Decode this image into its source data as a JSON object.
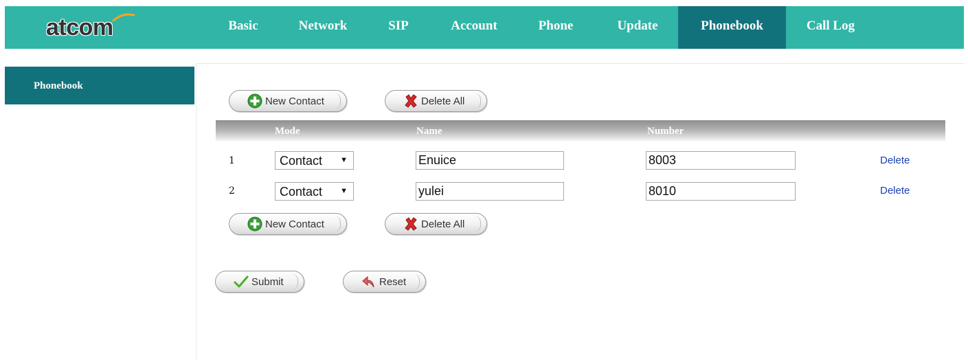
{
  "header": {
    "logo": "atcom",
    "nav": [
      {
        "label": "Basic"
      },
      {
        "label": "Network"
      },
      {
        "label": "SIP"
      },
      {
        "label": "Account"
      },
      {
        "label": "Phone"
      },
      {
        "label": "Update"
      },
      {
        "label": "Phonebook",
        "active": true
      },
      {
        "label": "Call Log"
      }
    ],
    "bar_color": "#30b5a7",
    "active_color": "#12727b"
  },
  "sidebar": {
    "items": [
      {
        "label": "Phonebook",
        "active": true
      }
    ]
  },
  "toolbar": {
    "new_contact_label": "New Contact",
    "delete_all_label": "Delete All"
  },
  "table": {
    "columns": {
      "mode": "Mode",
      "name": "Name",
      "number": "Number"
    },
    "rows": [
      {
        "index": "1",
        "mode": "Contact",
        "name": "Enuice",
        "number": "8003",
        "delete_label": "Delete"
      },
      {
        "index": "2",
        "mode": "Contact",
        "name": "yulei",
        "number": "8010",
        "delete_label": "Delete"
      }
    ]
  },
  "form": {
    "submit_label": "Submit",
    "reset_label": "Reset"
  }
}
